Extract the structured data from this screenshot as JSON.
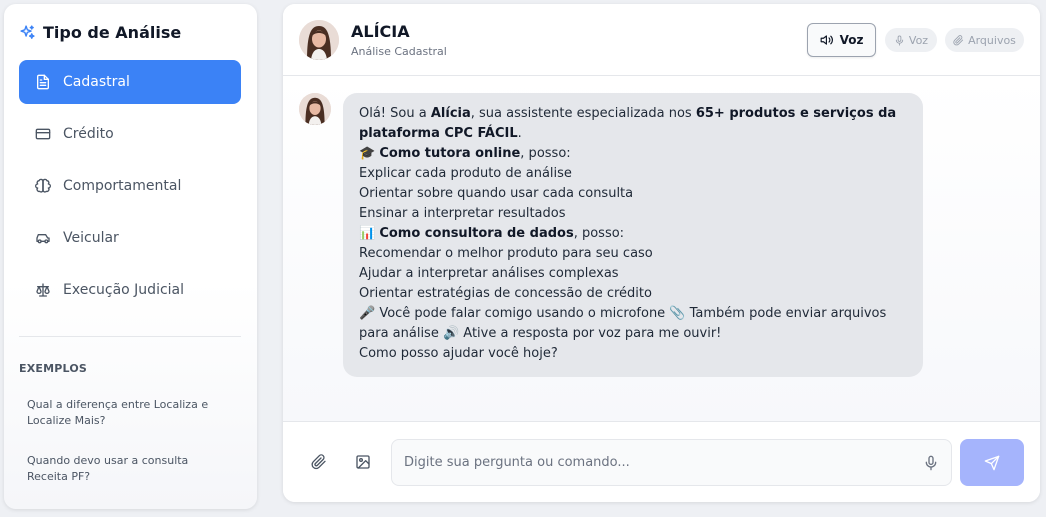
{
  "sidebar": {
    "title": "Tipo de Análise",
    "title_icon": "sparkles-icon",
    "items": [
      {
        "label": "Cadastral",
        "icon": "file-text-icon",
        "active": true
      },
      {
        "label": "Crédito",
        "icon": "credit-card-icon",
        "active": false
      },
      {
        "label": "Comportamental",
        "icon": "brain-icon",
        "active": false
      },
      {
        "label": "Veicular",
        "icon": "car-icon",
        "active": false
      },
      {
        "label": "Execução Judicial",
        "icon": "scale-icon",
        "active": false
      }
    ],
    "examples_title": "EXEMPLOS",
    "examples": [
      "Qual a diferença entre Localiza e Localize Mais?",
      "Quando devo usar a consulta Receita PF?"
    ]
  },
  "header": {
    "name": "ALÍCIA",
    "subtitle": "Análise Cadastral",
    "voice_button": "Voz",
    "voice_pill": "Voz",
    "files_pill": "Arquivos"
  },
  "message": {
    "p1_a": "Olá! Sou a ",
    "p1_b": "Alícia",
    "p1_c": ", sua assistente especializada nos ",
    "p1_d": "65+ produtos e serviços da plataforma CPC FÁCIL",
    "p1_e": ".",
    "s1_emoji": "🎓",
    "s1_bold": "Como tutora online",
    "s1_rest": ", posso:",
    "s1_items": [
      "Explicar cada produto de análise",
      "Orientar sobre quando usar cada consulta",
      "Ensinar a interpretar resultados"
    ],
    "s2_emoji": "📊",
    "s2_bold": "Como consultora de dados",
    "s2_rest": ", posso:",
    "s2_items": [
      "Recomendar o melhor produto para seu caso",
      "Ajudar a interpretar análises complexas",
      "Orientar estratégias de concessão de crédito"
    ],
    "tail": "🎤 Você pode falar comigo usando o microfone 📎 Também pode enviar arquivos para análise 🔊 Ative a resposta por voz para me ouvir!",
    "closing": "Como posso ajudar você hoje?"
  },
  "composer": {
    "placeholder": "Digite sua pergunta ou comando...",
    "value": ""
  },
  "colors": {
    "accent": "#3b82f6",
    "send_button": "#a5b4fc",
    "bubble": "#e5e7eb"
  }
}
